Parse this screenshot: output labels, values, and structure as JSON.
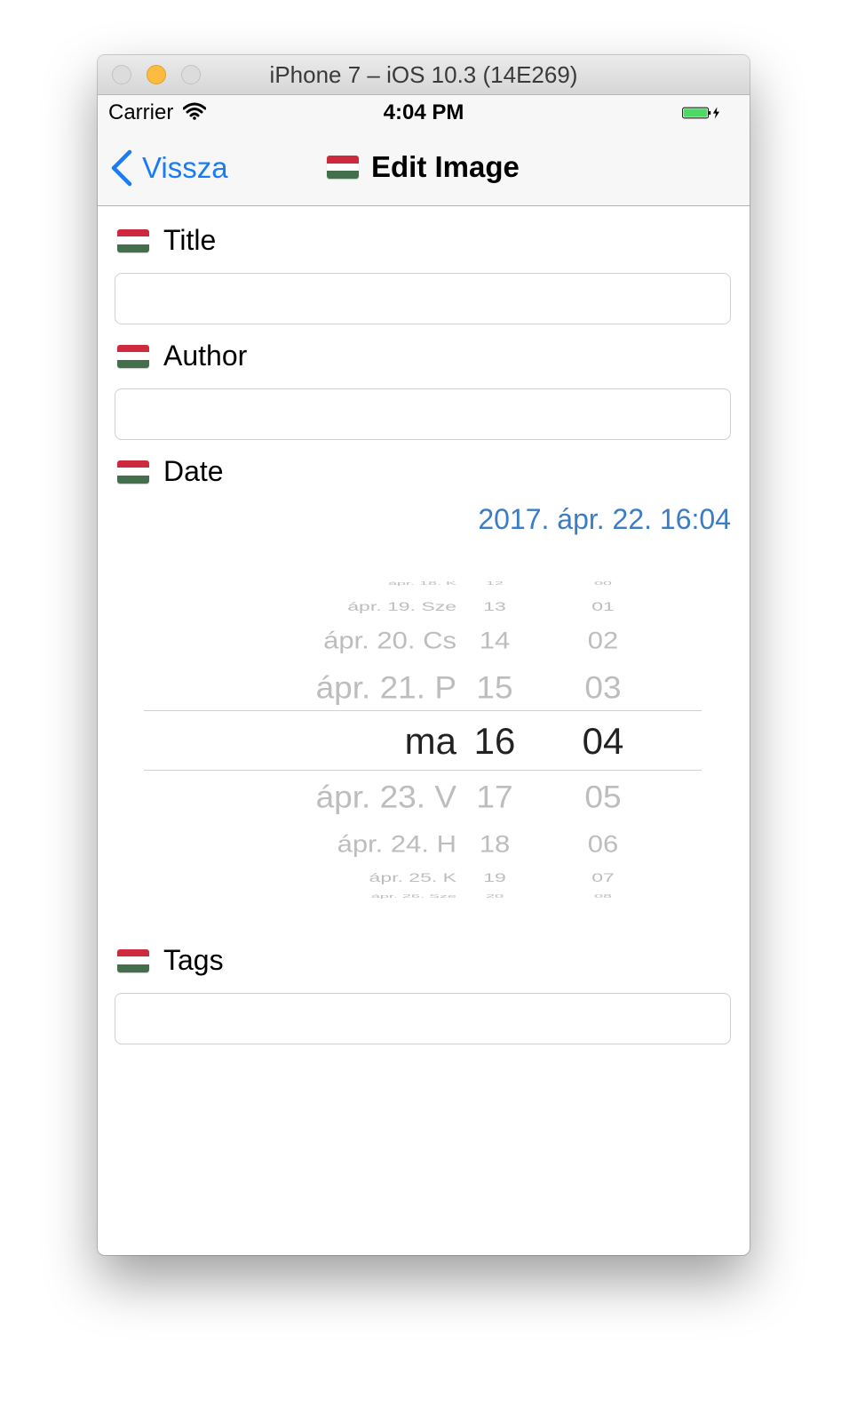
{
  "window": {
    "title": "iPhone 7 – iOS 10.3 (14E269)"
  },
  "status_bar": {
    "carrier": "Carrier",
    "time": "4:04 PM"
  },
  "nav": {
    "back_label": "Vissza",
    "title": "Edit Image",
    "back_icon": "chevron-left-icon",
    "flag_icon": "hungarian-flag-icon"
  },
  "form": {
    "title_label": "Title",
    "title_value": "",
    "author_label": "Author",
    "author_value": "",
    "date_label": "Date",
    "date_value": "2017. ápr. 22. 16:04",
    "tags_label": "Tags",
    "tags_value": ""
  },
  "picker": {
    "days": [
      "ápr. 18. K",
      "ápr. 19. Sze",
      "ápr. 20. Cs",
      "ápr. 21. P",
      "ma",
      "ápr. 23. V",
      "ápr. 24. H",
      "ápr. 25. K",
      "ápr. 26. Sze"
    ],
    "hours": [
      "12",
      "13",
      "14",
      "15",
      "16",
      "17",
      "18",
      "19",
      "20"
    ],
    "minutes": [
      "00",
      "01",
      "02",
      "03",
      "04",
      "05",
      "06",
      "07",
      "08"
    ],
    "selected_day": "ma",
    "selected_hour": "16",
    "selected_minute": "04"
  },
  "colors": {
    "accent": "#1a7cf4",
    "date_value": "#3c7cc4",
    "battery": "#4cd964"
  }
}
